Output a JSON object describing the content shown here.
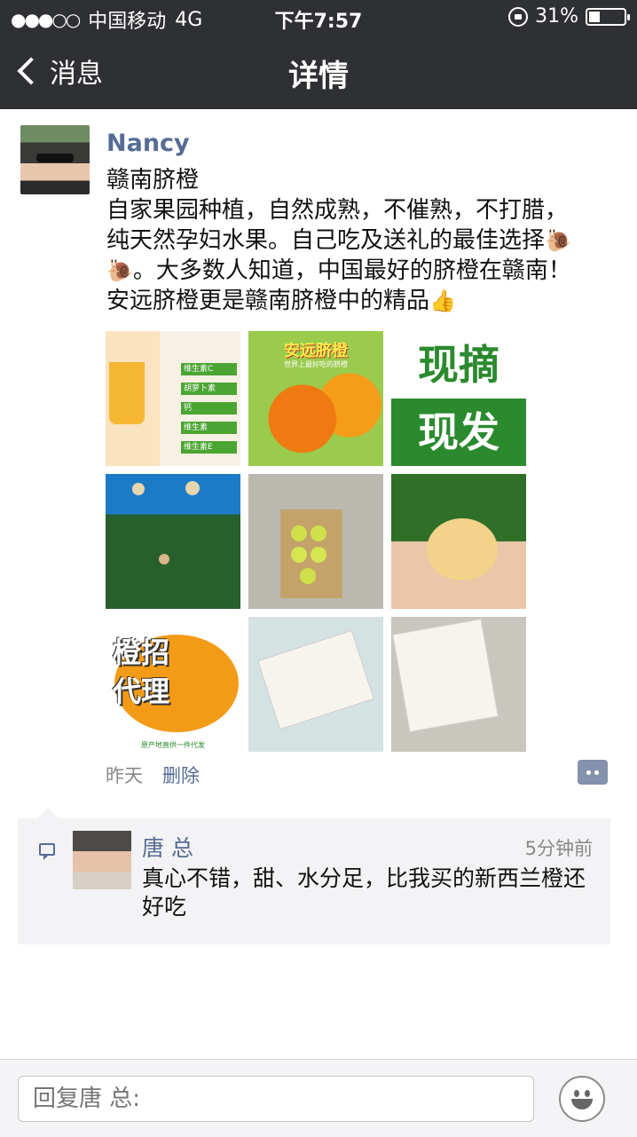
{
  "status_bar": {
    "signal_dots": "●●●○○",
    "carrier": "中国移动",
    "network": "4G",
    "time": "下午7:57",
    "battery": "31%",
    "battery_level": 0.31
  },
  "nav": {
    "back_label": "消息",
    "title": "详情"
  },
  "post": {
    "author": "Nancy",
    "text_lines": [
      "赣南脐橙",
      "自家果园种植，自然成熟，不催熟，不打腊，",
      "纯天然孕妇水果。自己吃及送礼的最佳选择",
      "。大多数人知道，中国最好的脐橙在赣南！",
      "安远脐橙更是赣南脐橙中的精品"
    ],
    "emoji": {
      "snail": "🐌",
      "thumbs_up": "👍"
    },
    "images": {
      "vitamins": [
        "维生素C",
        "胡萝卜素",
        "钙",
        "维生素",
        "维生素E"
      ],
      "brand_title": "安远脐橙",
      "brand_sub": "世界上最好吃的脐橙",
      "pick_top": "现摘",
      "pick_bottom": "现发",
      "agent_text_1": "橙招",
      "agent_text_2": "代理",
      "agent_footer": "原产地直供一件代发"
    },
    "time": "昨天",
    "delete_label": "删除"
  },
  "comment": {
    "author": "唐 总",
    "time": "5分钟前",
    "text": "真心不错，甜、水分足，比我买的新西兰橙还好吃"
  },
  "reply": {
    "placeholder": "回复唐 总:"
  }
}
